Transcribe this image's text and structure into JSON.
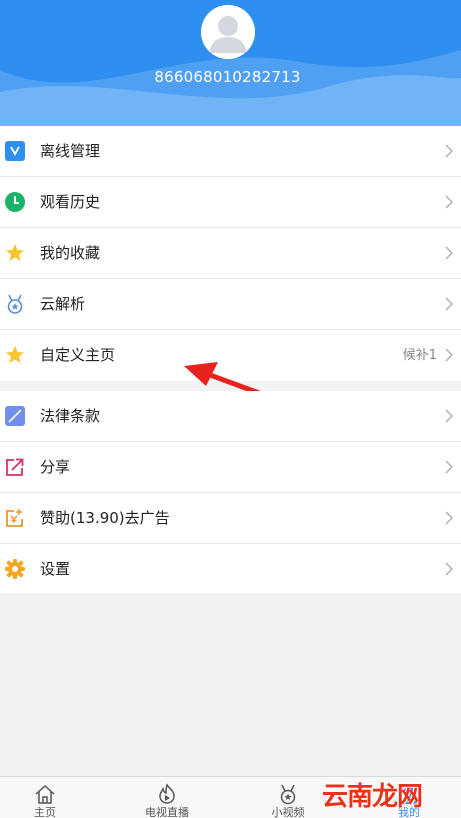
{
  "header": {
    "user_id": "866068010282713",
    "background_color": "#2f8ff0"
  },
  "menu_group_1": [
    {
      "label": "离线管理",
      "icon": "download-box-icon",
      "extra": ""
    },
    {
      "label": "观看历史",
      "icon": "clock-icon",
      "extra": ""
    },
    {
      "label": "我的收藏",
      "icon": "star-icon",
      "extra": ""
    },
    {
      "label": "云解析",
      "icon": "medal-icon",
      "extra": ""
    },
    {
      "label": "自定义主页",
      "icon": "star-icon",
      "extra": "候补1"
    }
  ],
  "menu_group_2": [
    {
      "label": "法律条款",
      "icon": "document-icon",
      "extra": ""
    },
    {
      "label": "分享",
      "icon": "share-icon",
      "extra": ""
    },
    {
      "label": "赞助(13.90)去广告",
      "icon": "sponsor-icon",
      "extra": ""
    },
    {
      "label": "设置",
      "icon": "gear-icon",
      "extra": ""
    }
  ],
  "tabbar": {
    "tabs": [
      {
        "label": "主页",
        "icon": "home-icon"
      },
      {
        "label": "电视直播",
        "icon": "tv-flame-icon"
      },
      {
        "label": "小视频",
        "icon": "medal-icon"
      },
      {
        "label": "我的",
        "icon": "user-icon"
      }
    ],
    "active_index": 3
  },
  "watermark": "云南龙网"
}
